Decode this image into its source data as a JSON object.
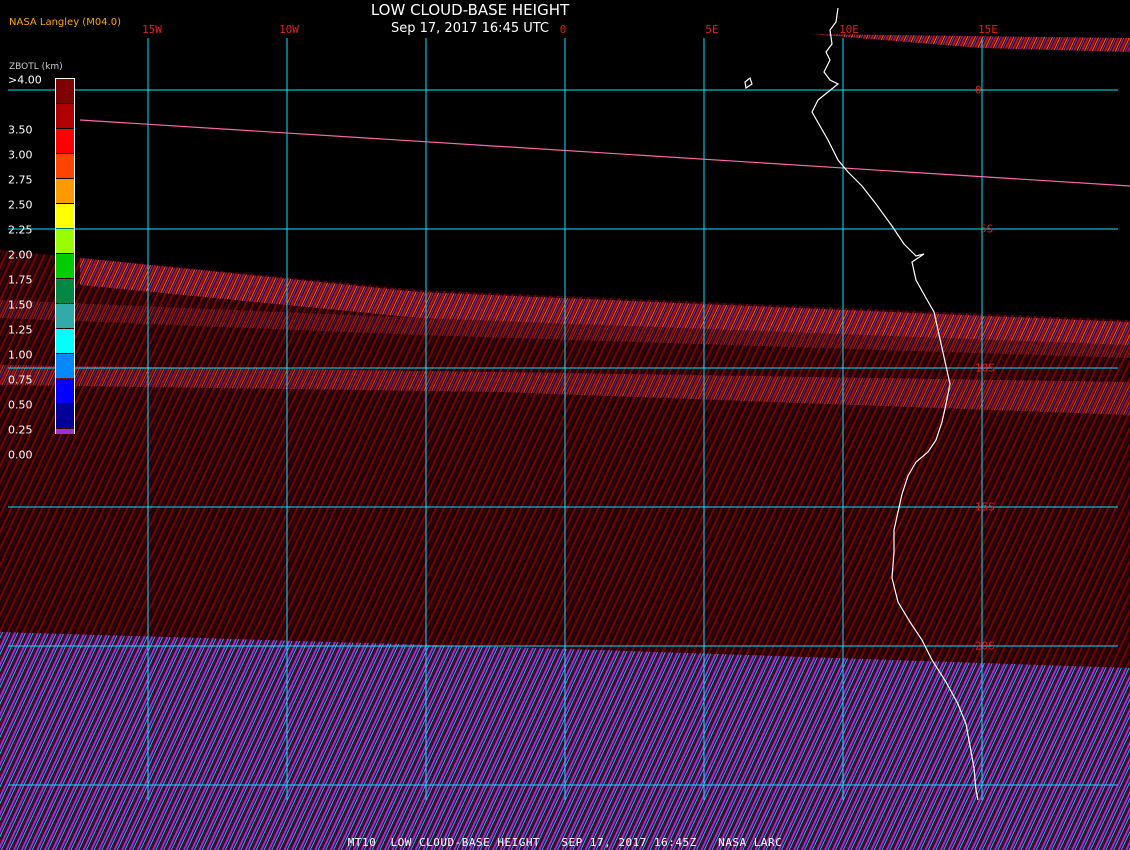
{
  "header": {
    "title": "LOW CLOUD-BASE HEIGHT",
    "datetime": "Sep 17, 2017 16:45 UTC",
    "org": "NASA Langley (M04.0)"
  },
  "footer": {
    "text": "MT10  LOW CLOUD-BASE HEIGHT   SEP 17, 2017 16:45Z   NASA LARC"
  },
  "map": {
    "lon_labels": [
      "15W",
      "10W",
      "0",
      "5E",
      "10E",
      "15E"
    ],
    "lat_labels": [
      "0",
      "5S",
      "10S",
      "15S",
      "20S"
    ]
  },
  "legend": {
    "title": "ZBOTL (km)",
    "labels": [
      ">4.00",
      "3.50",
      "3.00",
      "2.75",
      "2.50",
      "2.25",
      "2.00",
      "1.75",
      "1.50",
      "1.25",
      "1.00",
      "0.75",
      "0.50",
      "0.25",
      "0.00"
    ],
    "colors": [
      "#800000",
      "#b00000",
      "#ff0000",
      "#ff4400",
      "#ff9900",
      "#ffff00",
      "#99ff00",
      "#00cc00",
      "#008844",
      "#33aaaa",
      "#00ffff",
      "#0088ff",
      "#0000ff",
      "#000099",
      "#9933cc"
    ]
  },
  "colors": {
    "grid": "#00e5ff",
    "labels": "#dd2222",
    "coast": "#ffffff"
  }
}
